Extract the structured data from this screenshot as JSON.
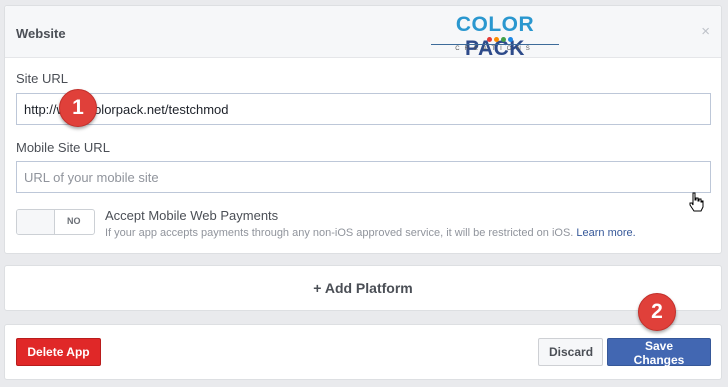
{
  "card": {
    "title": "Website",
    "logo": {
      "main": "COLOR PACK",
      "sub": "CREATIONS",
      "dot_colors": [
        "#e53935",
        "#fb8c00",
        "#43a047",
        "#1e88e5"
      ]
    },
    "close_glyph": "×",
    "site_url": {
      "label": "Site URL",
      "value": "http://www.colorpack.net/testchmod"
    },
    "mobile_site_url": {
      "label": "Mobile Site URL",
      "placeholder": "URL of your mobile site"
    },
    "mobile_payments": {
      "toggle_label": "NO",
      "title": "Accept Mobile Web Payments",
      "description": "If your app accepts payments through any non-iOS approved service, it will be restricted on iOS.",
      "link": "Learn more."
    }
  },
  "add_platform": {
    "icon": "plus-icon",
    "label": "+ Add Platform"
  },
  "footer": {
    "delete_label": "Delete App",
    "discard_label": "Discard",
    "save_label": "Save Changes"
  },
  "badges": {
    "first": "1",
    "second": "2"
  },
  "colors": {
    "primary": "#4267b2",
    "danger": "#e02828",
    "badge": "#e0403a",
    "link": "#365899",
    "page_bg": "#e9eaed"
  }
}
